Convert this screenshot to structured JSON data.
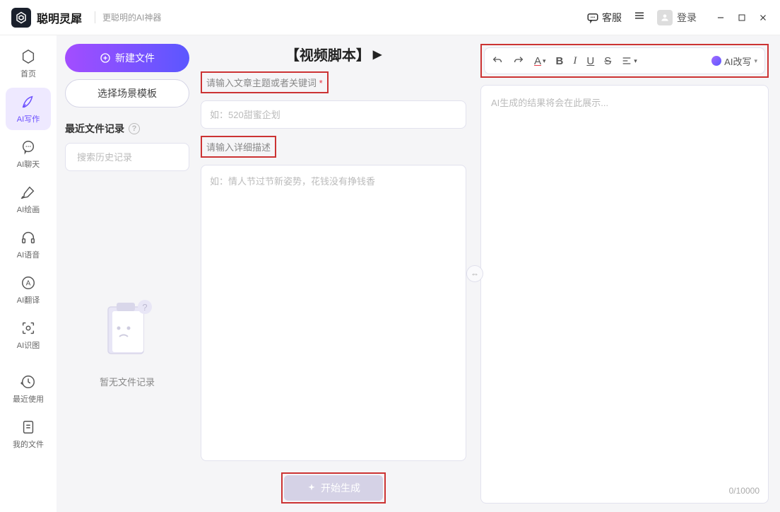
{
  "titlebar": {
    "app_name": "聪明灵犀",
    "app_tag": "更聪明的AI神器",
    "kefu_label": "客服",
    "login_label": "登录"
  },
  "sidebar": {
    "items": [
      {
        "label": "首页"
      },
      {
        "label": "AI写作"
      },
      {
        "label": "AI聊天"
      },
      {
        "label": "AI绘画"
      },
      {
        "label": "AI语音"
      },
      {
        "label": "AI翻译"
      },
      {
        "label": "AI识图"
      },
      {
        "label": "最近使用"
      },
      {
        "label": "我的文件"
      }
    ]
  },
  "files_panel": {
    "new_file": "新建文件",
    "choose_template": "选择场景模板",
    "recent_header": "最近文件记录",
    "search_placeholder": "搜索历史记录",
    "empty_text": "暂无文件记录"
  },
  "center": {
    "title": "【视频脚本】",
    "topic_label": "请输入文章主题或者关键词",
    "topic_placeholder": "如：520甜蜜企划",
    "detail_label": "请输入详细描述",
    "detail_placeholder": "如：情人节过节新姿势，花钱没有挣钱香",
    "generate_label": "开始生成"
  },
  "right": {
    "ai_rewrite": "AI改写",
    "output_placeholder": "AI生成的结果将会在此展示...",
    "char_count": "0/10000"
  }
}
